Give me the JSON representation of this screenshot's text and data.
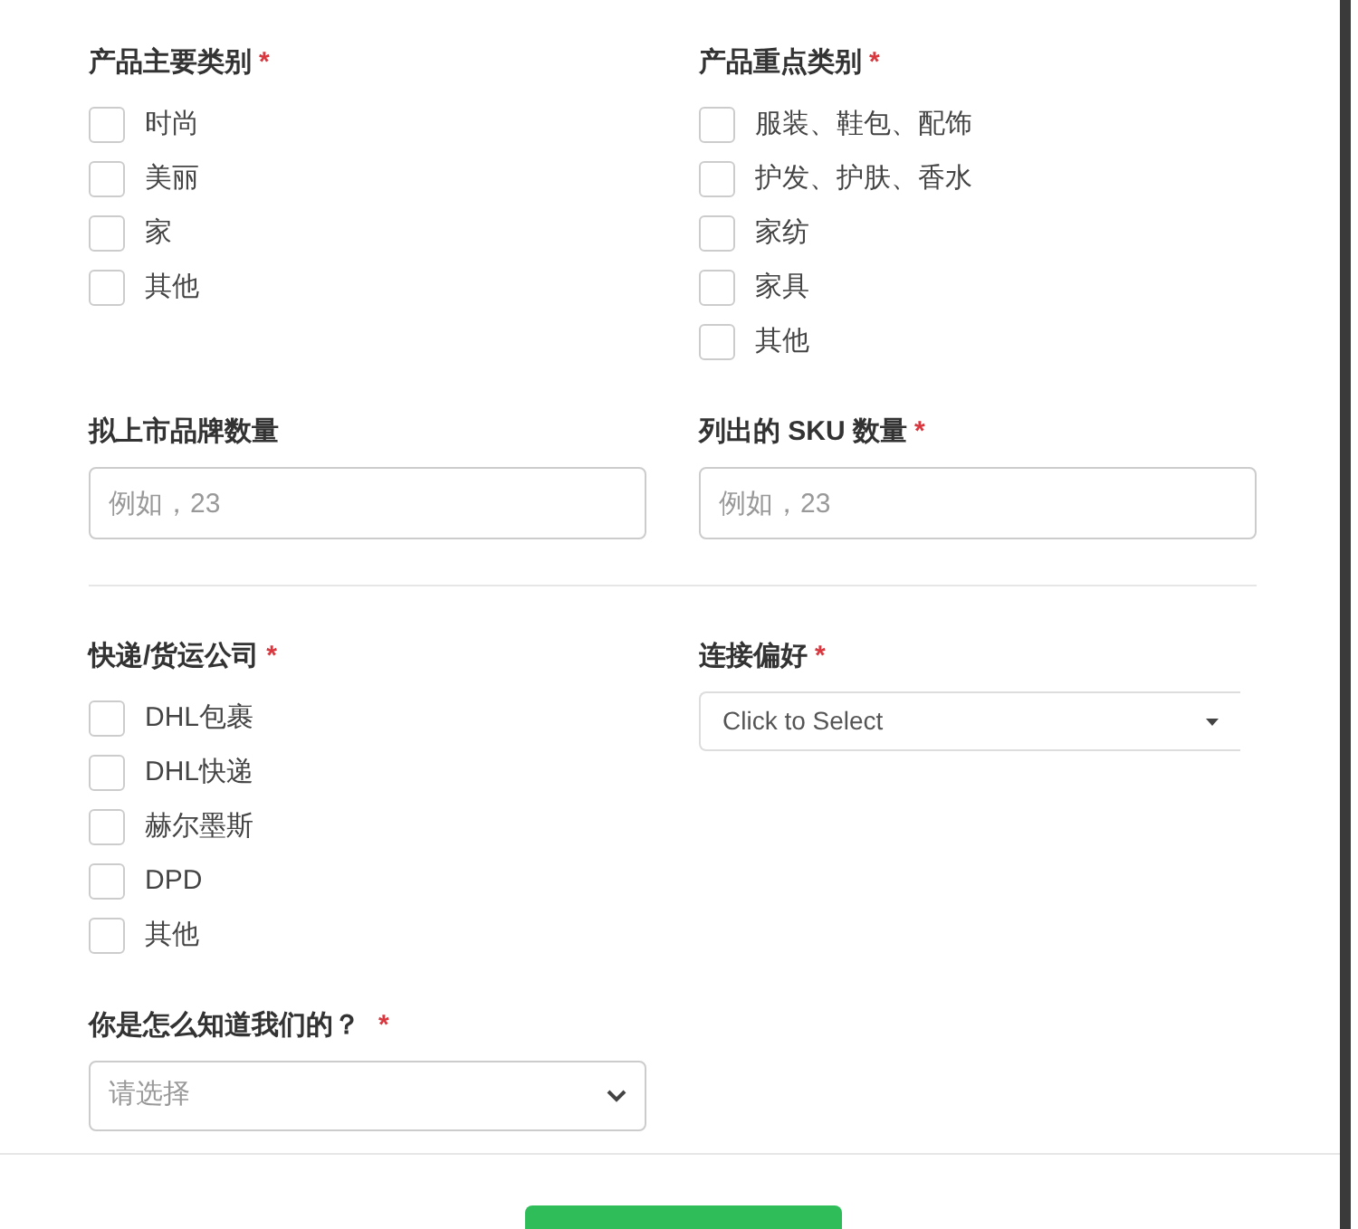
{
  "rows": [
    {
      "fields": [
        {
          "kind": "checkboxes",
          "label": "产品主要类别",
          "required_mark": "*",
          "options": [
            {
              "label": "时尚",
              "checked": false
            },
            {
              "label": "美丽",
              "checked": false
            },
            {
              "label": "家",
              "checked": false
            },
            {
              "label": "其他",
              "checked": false
            }
          ]
        },
        {
          "kind": "checkboxes",
          "label": "产品重点类别",
          "required_mark": "*",
          "options": [
            {
              "label": "服装、鞋包、配饰",
              "checked": false
            },
            {
              "label": "护发、护肤、香水",
              "checked": false
            },
            {
              "label": "家纺",
              "checked": false
            },
            {
              "label": "家具",
              "checked": false
            },
            {
              "label": "其他",
              "checked": false
            }
          ]
        }
      ]
    },
    {
      "fields": [
        {
          "kind": "input",
          "label": "拟上市品牌数量",
          "placeholder": "例如，23"
        },
        {
          "kind": "input",
          "label": "列出的 SKU 数量",
          "required_mark": "*",
          "placeholder": "例如，23"
        }
      ]
    },
    {
      "divider": true,
      "fields": [
        {
          "kind": "checkboxes",
          "label": "快递/货运公司",
          "required_mark": "*",
          "options": [
            {
              "label": "DHL包裹",
              "checked": false
            },
            {
              "label": "DHL快递",
              "checked": false
            },
            {
              "label": "赫尔墨斯",
              "checked": false
            },
            {
              "label": "DPD",
              "checked": false
            },
            {
              "label": "其他",
              "checked": false
            }
          ]
        },
        {
          "kind": "dropdown",
          "label": "连接偏好",
          "required_mark": "*",
          "value": "Click to Select"
        }
      ]
    },
    {
      "fields": [
        {
          "kind": "select",
          "label": "你是怎么知道我们的？",
          "required_mark": "*",
          "placeholder": "请选择"
        }
      ]
    }
  ]
}
